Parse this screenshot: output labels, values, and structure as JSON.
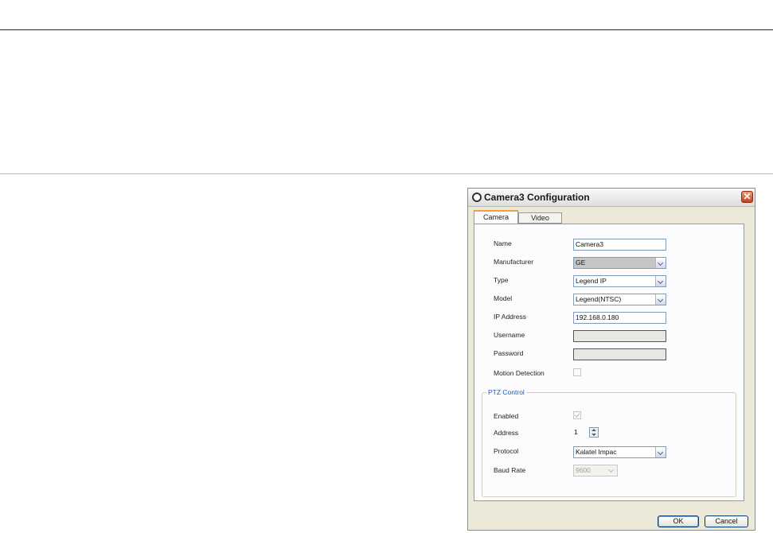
{
  "dialog": {
    "title": "Camera3 Configuration",
    "close_glyph": "✕",
    "tabs": [
      {
        "label": "Camera",
        "active": true
      },
      {
        "label": "Video",
        "active": false
      }
    ],
    "camera": {
      "name_label": "Name",
      "name_value": "Camera3",
      "manufacturer_label": "Manufacturer",
      "manufacturer_value": "GE",
      "type_label": "Type",
      "type_value": "Legend IP",
      "model_label": "Model",
      "model_value": "Legend(NTSC)",
      "ip_label": "IP Address",
      "ip_value": "192.168.0.180",
      "username_label": "Username",
      "username_value": "",
      "password_label": "Password",
      "password_value": "",
      "motion_label": "Motion Detection",
      "motion_checked": false
    },
    "ptz": {
      "group_label": "PTZ Control",
      "enabled_label": "Enabled",
      "enabled_checked": true,
      "address_label": "Address",
      "address_value": "1",
      "protocol_label": "Protocol",
      "protocol_value": "Kalatel Impac",
      "baud_label": "Baud Rate",
      "baud_value": "9600"
    },
    "buttons": {
      "ok": "OK",
      "cancel": "Cancel"
    }
  },
  "colors": {
    "tab_accent": "#f1a03a",
    "group_label": "#1f5ab3",
    "close_button": "#c3401d"
  },
  "icons": [
    "window-icon",
    "close-icon",
    "dropdown-arrow-icon",
    "spin-up-icon",
    "spin-down-icon",
    "checkbox-icon"
  ]
}
